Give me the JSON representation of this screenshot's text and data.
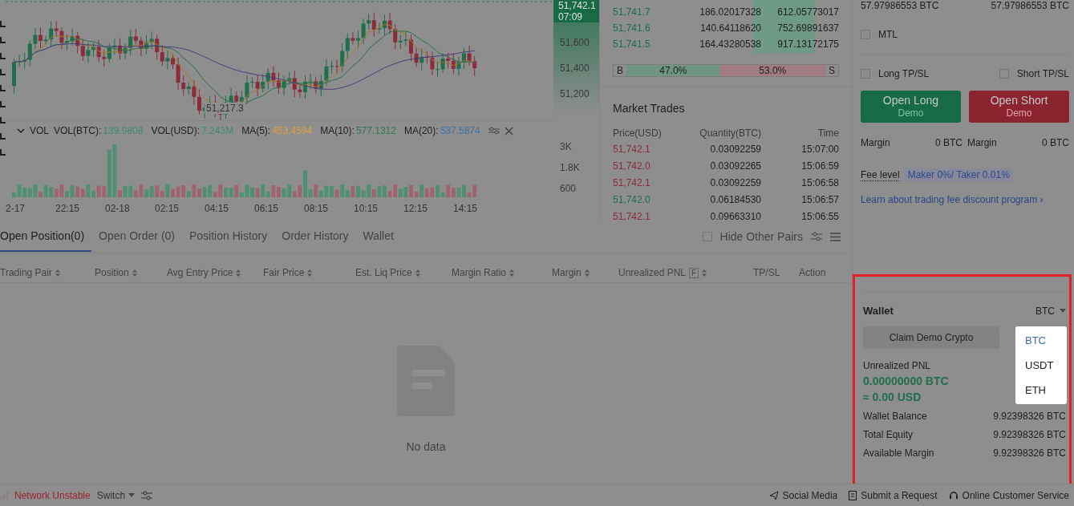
{
  "chart": {
    "price_tag": "51,742.1",
    "countdown": "07:09",
    "price_ticks": [
      "51,600",
      "51,400",
      "51,200"
    ],
    "low_marker": "51,217.3",
    "volume_title": "VOL",
    "volume_indicators": [
      {
        "label": "VOL(BTC):",
        "value": "139.9808",
        "color": "#3d8a74"
      },
      {
        "label": "VOL(USD):",
        "value": "7.243M",
        "color": "#3d8a74"
      },
      {
        "label": "MA(5):",
        "value": "453.4594",
        "color": "#d9a040"
      },
      {
        "label": "MA(10):",
        "value": "577.1312",
        "color": "#2f7a52"
      },
      {
        "label": "MA(20):",
        "value": "537.5874",
        "color": "#3b74a8"
      }
    ],
    "volume_ticks": [
      "3K",
      "1.8K",
      "600"
    ],
    "time_ticks": [
      "2-17",
      "22:15",
      "02-18",
      "02:15",
      "04:15",
      "06:15",
      "08:15",
      "10:15",
      "12:15",
      "14:15"
    ]
  },
  "order_book": {
    "rows": [
      {
        "price": "51,741.7",
        "amount": "186.02017328",
        "total": "612.05773017"
      },
      {
        "price": "51,741.6",
        "amount": "140.64118620",
        "total": "752.69891637"
      },
      {
        "price": "51,741.5",
        "amount": "164.43280538",
        "total": "917.13172175"
      }
    ],
    "ratio": {
      "buy_tag": "B",
      "buy": "47.0%",
      "sell": "53.0%",
      "sell_tag": "S",
      "level": 0.47
    }
  },
  "market_trades": {
    "title": "Market Trades",
    "columns": [
      "Price(USD)",
      "Quantity(BTC)",
      "Time"
    ],
    "rows": [
      {
        "price": "51,742.1",
        "quantity": "0.03092259",
        "time": "15:07:00",
        "color": "#8c2c3b"
      },
      {
        "price": "51,742.0",
        "quantity": "0.03092265",
        "time": "15:06:59",
        "color": "#8c2c3b"
      },
      {
        "price": "51,742.1",
        "quantity": "0.03092259",
        "time": "15:06:58",
        "color": "#8c2c3b"
      },
      {
        "price": "51,742.0",
        "quantity": "0.06184530",
        "time": "15:06:57",
        "color": "#1f6e4c"
      },
      {
        "price": "51,742.1",
        "quantity": "0.09663310",
        "time": "15:06:55",
        "color": "#8c2c3b"
      }
    ]
  },
  "order_panel": {
    "balances": [
      "57.97986553 BTC",
      "57.97986553 BTC"
    ],
    "mtl": {
      "label": "MTL",
      "checked": false
    },
    "tp_sl": [
      {
        "label": "Long TP/SL",
        "checked": false
      },
      {
        "label": "Short TP/SL",
        "checked": false
      }
    ],
    "actions": [
      {
        "label": "Open Long",
        "sub": "Demo",
        "kind": "long"
      },
      {
        "label": "Open Short",
        "sub": "Demo",
        "kind": "short"
      }
    ],
    "margins": [
      {
        "label": "Margin",
        "value": "0 BTC"
      },
      {
        "label": "Margin",
        "value": "0 BTC"
      }
    ],
    "fee_label": "Fee level",
    "fee_value": "Maker 0%/ Taker 0.01%",
    "fee_link": "Learn about trading fee discount program ›"
  },
  "wallet": {
    "title": "Wallet",
    "currency": "BTC",
    "claim_button": "Claim Demo Crypto",
    "pnl_label": "Unrealized PNL",
    "pnl_value": "0.00000000 BTC",
    "pnl_usd": "≈ 0.00 USD",
    "rows": [
      {
        "label": "Wallet Balance",
        "value": "9.92398326 BTC"
      },
      {
        "label": "Total Equity",
        "value": "9.92398326 BTC"
      },
      {
        "label": "Available Margin",
        "value": "9.92398326 BTC"
      }
    ],
    "dropdown": [
      {
        "label": "BTC",
        "selected": true
      },
      {
        "label": "USDT",
        "selected": false
      },
      {
        "label": "ETH",
        "selected": false
      }
    ]
  },
  "positions": {
    "tabs": [
      {
        "label": "Open Position(0)",
        "selected": true
      },
      {
        "label": "Open Order (0)",
        "selected": false
      },
      {
        "label": "Position History",
        "selected": false
      },
      {
        "label": "Order History",
        "selected": false
      },
      {
        "label": "Wallet",
        "selected": false
      }
    ],
    "hide_other_pairs": {
      "label": "Hide Other Pairs",
      "checked": false
    },
    "columns": [
      {
        "label": "Trading Pair",
        "sortable": true
      },
      {
        "label": "Position",
        "sortable": true
      },
      {
        "label": "Avg Entry Price",
        "sortable": true
      },
      {
        "label": "Fair Price",
        "sortable": true
      },
      {
        "label": "Est. Liq Price",
        "sortable": true
      },
      {
        "label": "Margin Ratio",
        "sortable": true
      },
      {
        "label": "Margin",
        "sortable": true
      },
      {
        "label": "Unrealized PNL",
        "badge": "F",
        "sortable": true
      },
      {
        "label": "TP/SL",
        "sortable": false
      },
      {
        "label": "Action",
        "sortable": false
      }
    ],
    "empty_text": "No data"
  },
  "status_bar": {
    "network": "Network Unstable",
    "switch": "Switch",
    "links": [
      {
        "label": "Social Media",
        "kind": "send"
      },
      {
        "label": "Submit a Request",
        "kind": "doc"
      },
      {
        "label": "Online Customer Service",
        "kind": "headset"
      }
    ]
  }
}
